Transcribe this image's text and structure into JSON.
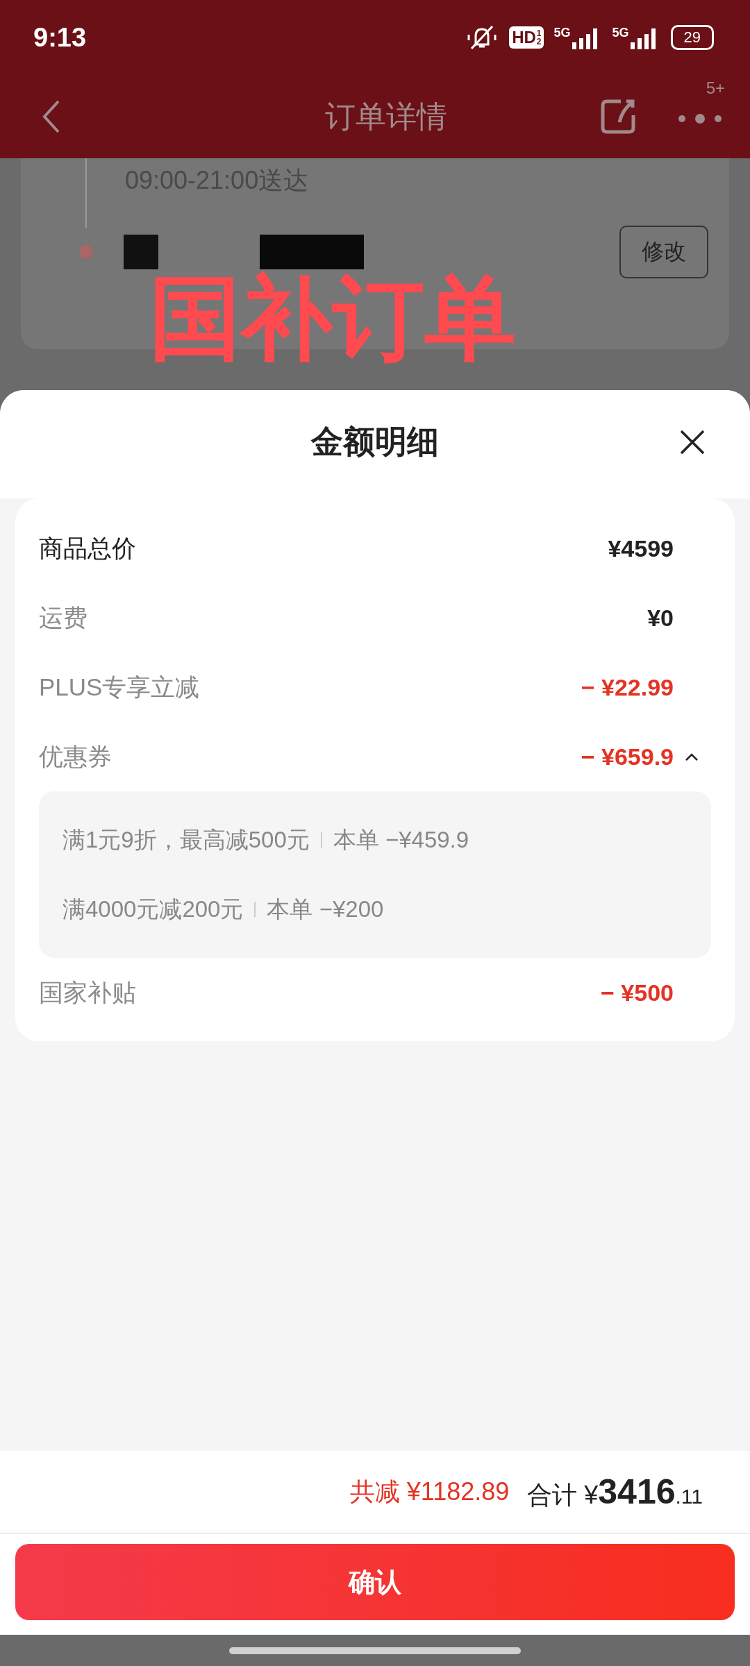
{
  "status_bar": {
    "time": "9:13",
    "hd": "HD",
    "hd_sup": "1",
    "hd_sub": "2",
    "networks": [
      "5G",
      "5G"
    ],
    "battery": "29"
  },
  "header": {
    "title": "订单详情",
    "badge": "5+"
  },
  "background_order": {
    "delivery_window": "09:00-21:00送达",
    "edit_button": "修改",
    "sticker": "国补订单"
  },
  "sheet": {
    "title": "金额明细",
    "rows": [
      {
        "kind": "total",
        "label": "商品总价",
        "value": "¥4599"
      },
      {
        "kind": "fee",
        "label": "运费",
        "value": "¥0"
      },
      {
        "kind": "discount",
        "label": "PLUS专享立减",
        "value": "− ¥22.99"
      },
      {
        "kind": "discount",
        "label": "优惠券",
        "value": "− ¥659.9",
        "expanded": true,
        "details": [
          {
            "condition": "满1元9折，最高减500元",
            "applied": "本单 −¥459.9"
          },
          {
            "condition": "满4000元减200元",
            "applied": "本单 −¥200"
          }
        ]
      },
      {
        "kind": "discount",
        "label": "国家补贴",
        "value": "− ¥500"
      }
    ]
  },
  "footer": {
    "savings_label": "共减",
    "savings": "¥1182.89",
    "total_label": "合计",
    "total_currency": "¥",
    "total_int": "3416",
    "total_dec": ".11",
    "confirm_button": "确认"
  }
}
